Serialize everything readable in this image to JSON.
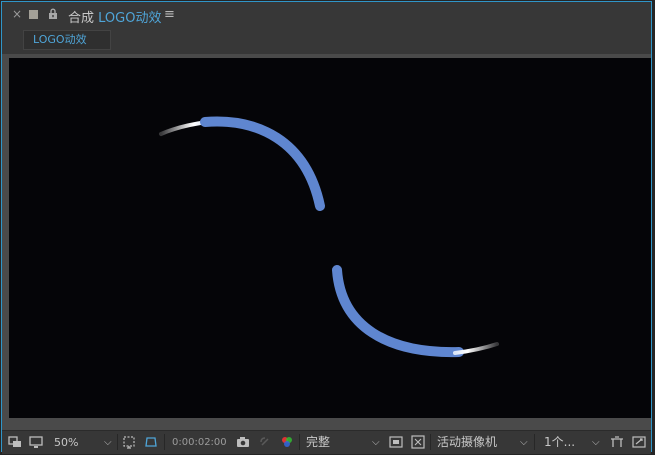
{
  "panel": {
    "close_glyph": "×",
    "title_prefix": "合成",
    "comp_name": "LOGO动效",
    "menu_glyph": "≡",
    "label_color": "#a3a097",
    "accent": "#4fa5d8"
  },
  "tab": {
    "label": "LOGO动效"
  },
  "viewer": {
    "background": "#050508",
    "stroke_color": "#5f86d0"
  },
  "bottombar": {
    "zoom": "50%",
    "timecode": "0:00:02:00",
    "resolution": "完整",
    "camera": "活动摄像机",
    "views": "1个...",
    "icons": [
      "always-preview-icon",
      "monitor-icon",
      "region-of-interest-icon",
      "transparency-grid-icon",
      "snapshot-camera-icon",
      "show-snapshot-icon",
      "color-channels-icon",
      "fast-preview-icon",
      "pixel-aspect-icon",
      "3d-view-layout-icon",
      "reset-exposure-icon"
    ]
  }
}
